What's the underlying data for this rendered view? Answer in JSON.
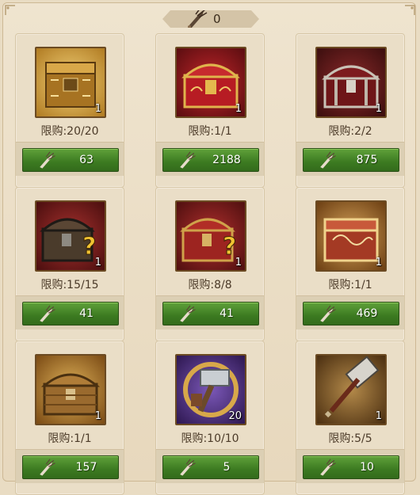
{
  "currency": {
    "icon": "conch-horn-icon",
    "amount": "0"
  },
  "items": [
    {
      "name": "golden-chest",
      "qty": "1",
      "limit": "限购:20/20",
      "price": "63"
    },
    {
      "name": "red-gold-chest",
      "qty": "1",
      "limit": "限购:1/1",
      "price": "2188"
    },
    {
      "name": "red-silver-chest",
      "qty": "1",
      "limit": "限购:2/2",
      "price": "875"
    },
    {
      "name": "iron-mystery-chest",
      "qty": "1",
      "limit": "限购:15/15",
      "price": "41"
    },
    {
      "name": "red-mystery-chest",
      "qty": "1",
      "limit": "限购:8/8",
      "price": "41"
    },
    {
      "name": "ornate-red-chest",
      "qty": "1",
      "limit": "限购:1/1",
      "price": "469"
    },
    {
      "name": "wooden-chest",
      "qty": "1",
      "limit": "限购:1/1",
      "price": "157"
    },
    {
      "name": "hammer-token",
      "qty": "20",
      "limit": "限购:10/10",
      "price": "5"
    },
    {
      "name": "war-hammer",
      "qty": "1",
      "limit": "限购:5/5",
      "price": "10"
    }
  ]
}
